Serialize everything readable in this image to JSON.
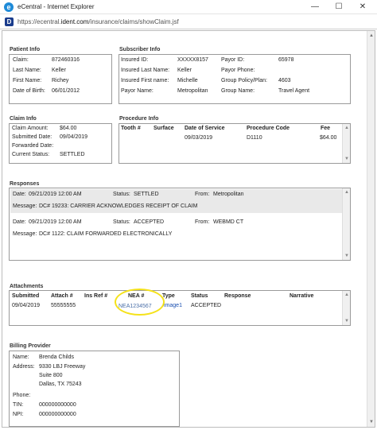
{
  "window": {
    "app_icon": "ie-icon",
    "title": "eCentral - Internet Explorer",
    "minimize_label": "—",
    "maximize_label": "☐",
    "close_label": "✕"
  },
  "address": {
    "favicon": "D",
    "url_prefix": "https://ecentral.",
    "url_host": "ident.com",
    "url_path": "/insurance/claims/showClaim.jsf"
  },
  "patient_info": {
    "label": "Patient Info",
    "fields": [
      {
        "key": "Claim:",
        "value": "872460316"
      },
      {
        "key": "Last Name:",
        "value": "Keller"
      },
      {
        "key": "First Name:",
        "value": "Richey"
      },
      {
        "key": "Date of Birth:",
        "value": "06/01/2012"
      }
    ]
  },
  "subscriber_info": {
    "label": "Subscriber Info",
    "left": [
      {
        "key": "Insured ID:",
        "value": "XXXXX8157"
      },
      {
        "key": "Insured Last Name:",
        "value": "Keller"
      },
      {
        "key": "Insured First name:",
        "value": "Michelle"
      },
      {
        "key": "Payor Name:",
        "value": "Metropolitan"
      }
    ],
    "right": [
      {
        "key": "Payor ID:",
        "value": "65978"
      },
      {
        "key": "Payor Phone:",
        "value": ""
      },
      {
        "key": "Group Policy/Plan:",
        "value": "4603"
      },
      {
        "key": "Group Name:",
        "value": "Travel Agent"
      }
    ]
  },
  "claim_info": {
    "label": "Claim Info",
    "fields": [
      {
        "key": "Claim Amount:",
        "value": "$64.00"
      },
      {
        "key": "Submitted Date:",
        "value": "09/04/2019"
      },
      {
        "key": "Forwarded Date:",
        "value": ""
      },
      {
        "key": "Current Status:",
        "value": "SETTLED"
      }
    ]
  },
  "procedure_info": {
    "label": "Procedure Info",
    "headers": {
      "tooth": "Tooth #",
      "surface": "Surface",
      "date": "Date of Service",
      "code": "Procedure Code",
      "fee": "Fee"
    },
    "rows": [
      {
        "tooth": "",
        "surface": "",
        "date": "09/03/2019",
        "code": "D1110",
        "fee": "$64.00"
      }
    ]
  },
  "responses": {
    "label": "Responses",
    "date_key": "Date:",
    "status_key": "Status:",
    "from_key": "From:",
    "message_key": "Message:",
    "items": [
      {
        "date": "09/21/2019 12:00 AM",
        "status": "SETTLED",
        "from": "Metropolitan",
        "message": "DC# 19233: CARRIER ACKNOWLEDGES RECEIPT OF CLAIM"
      },
      {
        "date": "09/21/2019 12:00 AM",
        "status": "ACCEPTED",
        "from": "WEBMD CT",
        "message": "DC# 1122: CLAIM FORWARDED ELECTRONICALLY"
      }
    ]
  },
  "attachments": {
    "label": "Attachments",
    "headers": {
      "submitted": "Submitted",
      "attach": "Attach #",
      "insref": "Ins Ref #",
      "nea": "NEA #",
      "type": "Type",
      "status": "Status",
      "response": "Response",
      "narrative": "Narrative"
    },
    "rows": [
      {
        "submitted": "09/04/2019",
        "attach": "55555555",
        "insref": "",
        "nea": "NEA1234567",
        "type": "image1",
        "status": "ACCEPTED",
        "response": "",
        "narrative": ""
      }
    ]
  },
  "billing_provider": {
    "label": "Billing Provider",
    "name_key": "Name:",
    "name": "Brenda Childs",
    "address_key": "Address:",
    "address_lines": [
      "9330 LBJ Freeway",
      "Suite 800",
      "Dallas, TX 75243"
    ],
    "phone_key": "Phone:",
    "phone": "",
    "tin_key": "TIN:",
    "tin": "000000000000",
    "npi_key": "NPI:",
    "npi": "000000000000"
  },
  "colors": {
    "link": "#1a4fb0",
    "highlight": "#f5e21a",
    "ie_blue": "#1f8bd8"
  }
}
